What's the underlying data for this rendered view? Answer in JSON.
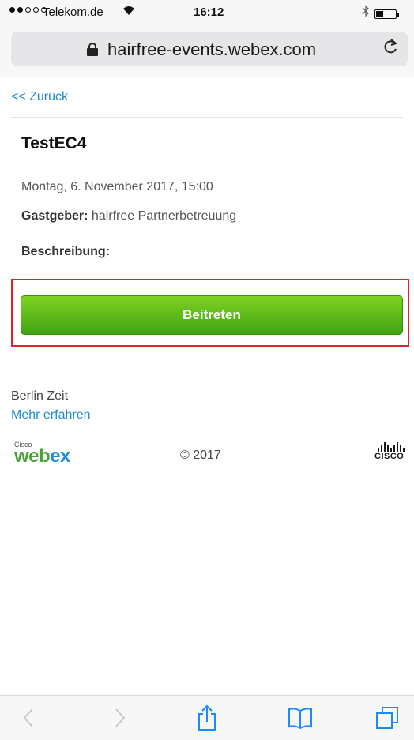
{
  "status_bar": {
    "carrier": "Telekom.de",
    "time": "16:12"
  },
  "address_bar": {
    "url": "hairfree-events.webex.com"
  },
  "page": {
    "back_link": "<< Zurück",
    "event_title": "TestEC4",
    "datetime": "Montag, 6. November 2017, 15:00",
    "host_label": "Gastgeber:",
    "host_value": "hairfree Partnerbetreuung",
    "description_label": "Beschreibung:",
    "join_button": "Beitreten",
    "timezone": "Berlin Zeit",
    "more_link": "Mehr erfahren"
  },
  "footer": {
    "logo_small": "Cisco",
    "logo_we": "web",
    "logo_ex": "ex",
    "copyright": "© 2017",
    "cisco_word": "CISCO"
  },
  "colors": {
    "link": "#1e8cd1",
    "join_button": "#4caf1f",
    "highlight_border": "#e3202a",
    "toolbar_icon": "#1a8cff"
  },
  "toolbar": {
    "icons": [
      "back-icon",
      "forward-icon",
      "share-icon",
      "bookmarks-icon",
      "tabs-icon"
    ]
  }
}
